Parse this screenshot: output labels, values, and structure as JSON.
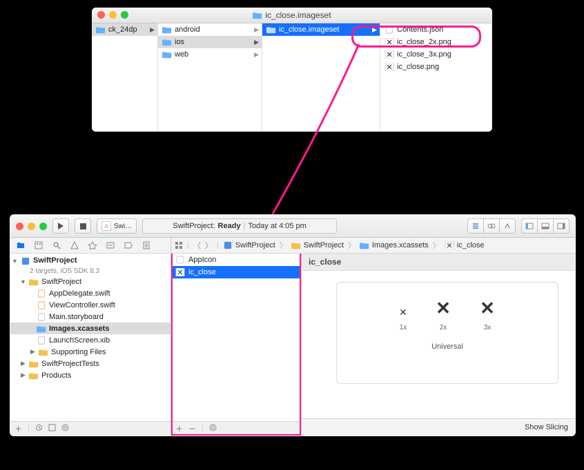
{
  "finder": {
    "title": "ic_close.imageset",
    "col0": {
      "item": "ck_24dp"
    },
    "col1": {
      "items": [
        {
          "name": "android",
          "sel": false
        },
        {
          "name": "ios",
          "sel": "gray"
        },
        {
          "name": "web",
          "sel": false
        }
      ]
    },
    "col2": {
      "item": "ic_close.imageset"
    },
    "col3": {
      "items": [
        {
          "name": "Contents.json",
          "type": "file"
        },
        {
          "name": "ic_close_2x.png",
          "type": "img"
        },
        {
          "name": "ic_close_3x.png",
          "type": "img"
        },
        {
          "name": "ic_close.png",
          "type": "img"
        }
      ]
    }
  },
  "xcode": {
    "toolbar": {
      "scheme_icon": "A",
      "scheme_text": "Swi…",
      "status_left": "SwiftProject:",
      "status_state": "Ready",
      "status_sep": "|",
      "status_right": "Today at 4:05 pm"
    },
    "jumpbar": {
      "items": [
        {
          "icon": "proj",
          "text": "SwiftProject"
        },
        {
          "icon": "folder",
          "text": "SwiftProject"
        },
        {
          "icon": "folder",
          "text": "Images.xcassets"
        },
        {
          "icon": "imageset",
          "text": "ic_close"
        }
      ]
    },
    "tree": {
      "project": "SwiftProject",
      "subtitle": "2 targets, iOS SDK 8.3",
      "folder1": "SwiftProject",
      "files": [
        {
          "name": "AppDelegate.swift",
          "icon": "swift"
        },
        {
          "name": "ViewController.swift",
          "icon": "swift"
        },
        {
          "name": "Main.storyboard",
          "icon": "storyboard"
        },
        {
          "name": "Images.xcassets",
          "icon": "assets",
          "sel": true
        },
        {
          "name": "LaunchScreen.xib",
          "icon": "xib"
        }
      ],
      "supporting": "Supporting Files",
      "folder2": "SwiftProjectTests",
      "folder3": "Products"
    },
    "assets": {
      "items": [
        {
          "name": "AppIcon",
          "sel": false,
          "icon": "app"
        },
        {
          "name": "ic_close",
          "sel": true,
          "icon": "img"
        }
      ]
    },
    "detail": {
      "title": "ic_close",
      "labels": [
        "1x",
        "2x",
        "3x"
      ],
      "universal": "Universal",
      "show_slicing": "Show Slicing"
    }
  }
}
